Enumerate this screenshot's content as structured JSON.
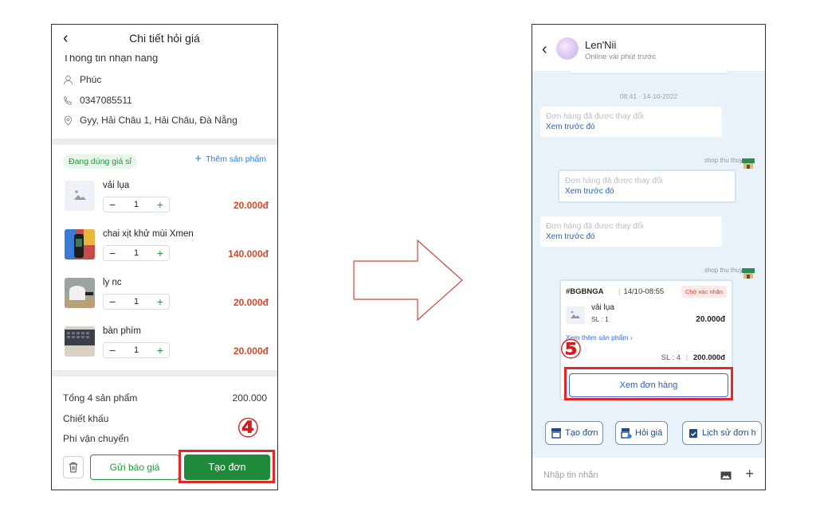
{
  "left": {
    "title": "Chi tiết hỏi giá",
    "section_title": "Thông tin nhận hàng",
    "customer_name": "Phúc",
    "phone": "0347085511",
    "address": "Gyy, Hải Châu 1, Hải Châu, Đà Nẵng",
    "badge": "Đang dùng giá sỉ",
    "add_product": "Thêm sản phẩm",
    "products": [
      {
        "name": "vải lụa",
        "qty": "1",
        "price": "20.000đ",
        "thumb": "image-placeholder-icon"
      },
      {
        "name": "chai xịt khử mùi Xmen",
        "qty": "1",
        "price": "140.000đ",
        "thumb": "product-photo"
      },
      {
        "name": "ly nc",
        "qty": "1",
        "price": "20.000đ",
        "thumb": "product-photo"
      },
      {
        "name": "bàn phím",
        "qty": "1",
        "price": "20.000đ",
        "thumb": "product-photo"
      }
    ],
    "total_label": "Tổng 4 sản phẩm",
    "total_value": "200.000",
    "discount_label": "Chiết khấu",
    "shipping_label": "Phí vận chuyển",
    "quote_button": "Gửi báo giá",
    "create_button": "Tạo đơn",
    "step_marker": "④"
  },
  "right": {
    "contact_name": "Len'Nii",
    "contact_status": "Online vài phút trước",
    "time": "08:41 · 14-10-2022",
    "changed_text": "Đơn hàng đã được thay đổi",
    "view_previous": "Xem trước đó",
    "sender": "shop thu thuy",
    "order": {
      "code": "#BGBNGA",
      "time": "14/10-08:55",
      "status": "Chờ xác nhận",
      "item": "vải lụa",
      "sl": "SL : 1",
      "price": "20.000đ",
      "more": "Xem thêm sản phẩm",
      "summary_count": "SL : 4",
      "summary_total": "200.000đ",
      "view_button": "Xem đơn hàng"
    },
    "step_marker": "⑤",
    "quick_actions": [
      "Tạo đơn",
      "Hỏi giá",
      "Lịch sử đơn h"
    ],
    "input_placeholder": "Nhập tin nhắn"
  },
  "colors": {
    "accent_green": "#1f8a3a",
    "price_red": "#d4482a",
    "highlight_red": "#e32626",
    "link_blue": "#2d5fb3"
  }
}
